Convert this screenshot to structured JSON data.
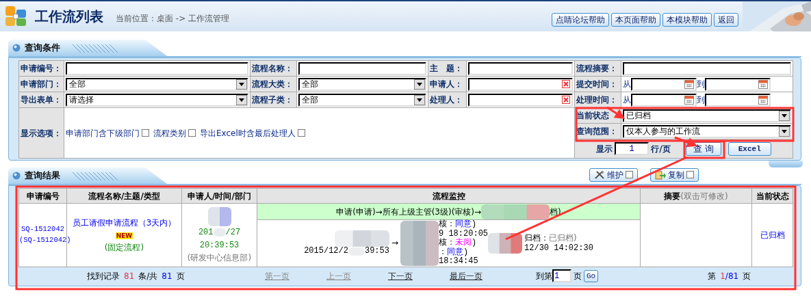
{
  "header": {
    "title": "工作流列表",
    "breadcrumb": "当前位置：桌面 -> 工作流管理",
    "buttons": [
      "点睛论坛帮助",
      "本页面帮助",
      "本模块帮助",
      "返回"
    ]
  },
  "query_panel": {
    "title": "查询条件",
    "rows": [
      [
        {
          "label": "申请编号：",
          "kind": "text"
        },
        {
          "label": "流程名称：",
          "kind": "text"
        },
        {
          "label": "主　题：",
          "kind": "text"
        },
        {
          "label": "流程摘要：",
          "kind": "text"
        }
      ],
      [
        {
          "label": "申请部门：",
          "kind": "select",
          "value": "全部"
        },
        {
          "label": "流程大类：",
          "kind": "select",
          "value": "全部"
        },
        {
          "label": "申请人：",
          "kind": "person"
        },
        {
          "label": "提交时间：",
          "kind": "daterange",
          "from": "从",
          "to": "到"
        }
      ],
      [
        {
          "label": "导出表单：",
          "kind": "select",
          "value": "请选择"
        },
        {
          "label": "流程子类：",
          "kind": "select",
          "value": "全部"
        },
        {
          "label": "处理人：",
          "kind": "person"
        },
        {
          "label": "处理时间：",
          "kind": "daterange",
          "from": "从",
          "to": "到"
        }
      ]
    ],
    "display_options": {
      "label": "显示选项：",
      "options": [
        {
          "label": "申请部门含下级部门",
          "checked": false
        },
        {
          "label": "流程类别",
          "checked": false
        },
        {
          "label": "导出Excel时含最后处理人",
          "checked": false
        }
      ]
    },
    "status_select": {
      "label": "当前状态",
      "value": "已归档"
    },
    "scope_select": {
      "label": "查询范围：",
      "value": "仅本人参与的工作流"
    },
    "page_size": {
      "prefix": "显示",
      "value": "1",
      "suffix": "行/页"
    },
    "buttons": [
      "查 询",
      "Excel"
    ]
  },
  "results_panel": {
    "title": "查询结果",
    "tools": [
      {
        "label": "维护",
        "kind": "tools",
        "checked": false
      },
      {
        "label": "复制",
        "kind": "copy",
        "checked": false
      }
    ],
    "columns": [
      {
        "label": "申请编号"
      },
      {
        "label": "流程名称/主题/类型"
      },
      {
        "label": "申请人/时间/部门"
      },
      {
        "label": "流程监控"
      },
      {
        "label": "摘要",
        "note": "(双击可修改)"
      },
      {
        "label": "当前状态"
      }
    ],
    "rows": [
      {
        "id": "SQ-1512042",
        "id_alt": "(SQ-1512042)",
        "flow_name": "员工请假申请流程（3天内）",
        "new_badge": "NEW",
        "flow_type": "(固定流程)",
        "date_start": "201",
        "date_end": "/27",
        "time": "20:39:53",
        "dept": "(研发中心信息部)",
        "monitor": {
          "route_start": "申请(申请)→所有上级主管(3级)(审核)→",
          "route_end": "档)",
          "start_date": "2015/12/2",
          "start_time": "39:53",
          "arrow": "→",
          "steps": [
            {
              "prefix": "核：",
              "status": "同意",
              "suffix": ")",
              "kind": "agree"
            },
            {
              "prefix": "9 18:20:05"
            },
            {
              "prefix": "核：",
              "status": "未阅",
              "suffix": ")",
              "kind": "unread"
            },
            {
              "prefix": "：",
              "status": "同意",
              "suffix": ")",
              "kind": "agree"
            },
            {
              "prefix": "18:34:45"
            }
          ],
          "end_prefix": "归档：",
          "end_status": "已归档)",
          "end_time": "12/30 14:02:30"
        },
        "status": "已归档"
      }
    ],
    "pager": {
      "found_prefix": "找到记录",
      "found_count": "81",
      "found_mid": "条/共",
      "page_total": "81",
      "found_suffix": "页",
      "nav": [
        {
          "label": "第一页",
          "disabled": true
        },
        {
          "label": "上一页",
          "disabled": true
        },
        {
          "label": "下一页",
          "disabled": false
        },
        {
          "label": "最后一页",
          "disabled": false
        }
      ],
      "goto_prefix": "到第",
      "goto_value": "1",
      "goto_suffix": "页",
      "go_button": "Go",
      "current_prefix": "第",
      "current_page": "1",
      "current_total": "/81",
      "current_suffix": "页"
    }
  }
}
